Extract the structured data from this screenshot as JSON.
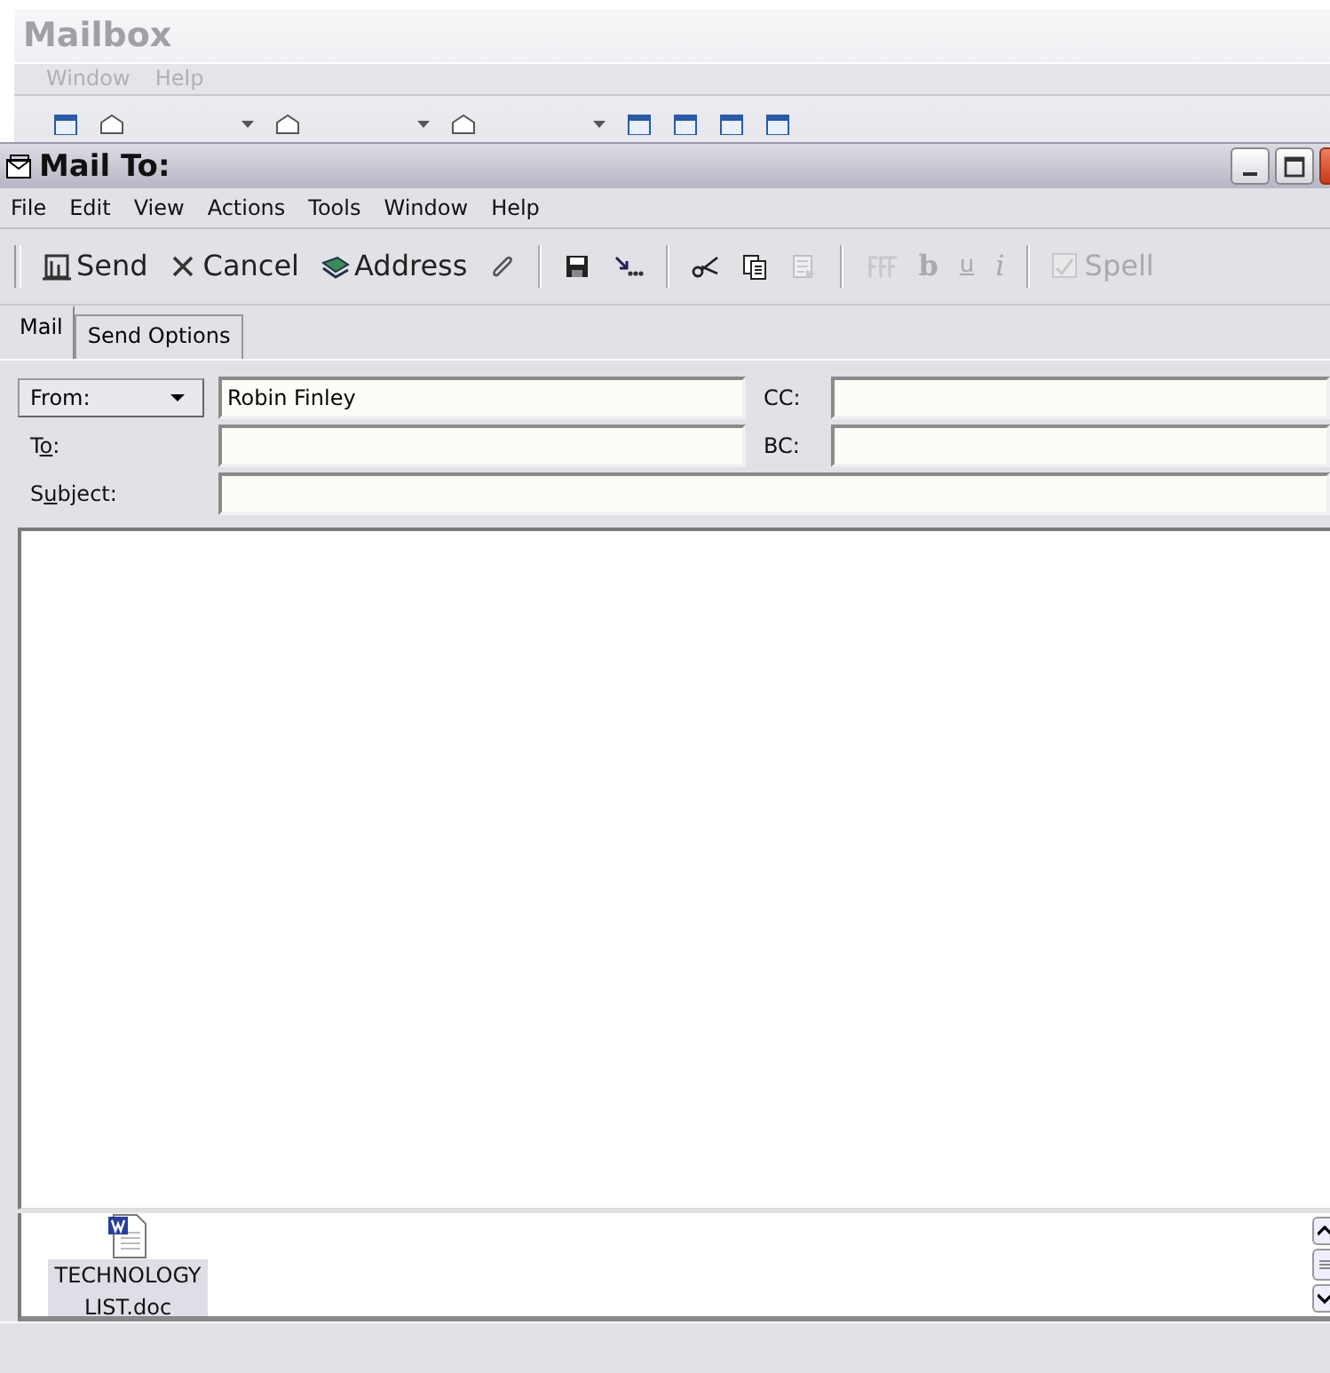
{
  "background_window": {
    "title": "Mailbox",
    "menu": [
      "Window",
      "Help"
    ],
    "toolbar": [
      {
        "kind": "icon"
      },
      {
        "kind": "split"
      },
      {
        "kind": "split"
      },
      {
        "kind": "split"
      },
      {
        "kind": "icon"
      },
      {
        "kind": "icon"
      },
      {
        "kind": "icon"
      },
      {
        "kind": "icon"
      }
    ]
  },
  "window": {
    "title": "Mail To:"
  },
  "menu": [
    "File",
    "Edit",
    "View",
    "Actions",
    "Tools",
    "Window",
    "Help"
  ],
  "toolbar": [
    {
      "kind": "send",
      "label": "Send",
      "disabled": false
    },
    {
      "kind": "cancel",
      "label": "Cancel",
      "disabled": false
    },
    {
      "kind": "address",
      "label": "Address",
      "disabled": false
    },
    {
      "kind": "attach",
      "disabled": false
    },
    {
      "kind": "sep"
    },
    {
      "kind": "save",
      "disabled": false
    },
    {
      "kind": "post",
      "disabled": false
    },
    {
      "kind": "sep"
    },
    {
      "kind": "cut",
      "disabled": false
    },
    {
      "kind": "copy",
      "disabled": false
    },
    {
      "kind": "paste",
      "disabled": true
    },
    {
      "kind": "sep"
    },
    {
      "kind": "font",
      "disabled": true
    },
    {
      "kind": "bold",
      "label": "b",
      "disabled": true
    },
    {
      "kind": "underline",
      "label": "u",
      "disabled": true
    },
    {
      "kind": "italic",
      "label": "i",
      "disabled": true
    },
    {
      "kind": "sep"
    },
    {
      "kind": "spell",
      "label": "Spell",
      "disabled": true
    }
  ],
  "tabs": [
    {
      "label": "Mail",
      "selected": true
    },
    {
      "label": "Send Options",
      "selected": false
    }
  ],
  "form": {
    "from_button": "From:",
    "from": "Robin Finley",
    "cc_label": "CC:",
    "to_label": "T**o**:",
    "bc_label": "BC:",
    "subject_label": "S**u**bject:"
  },
  "attachments": [
    {
      "name": "TECHNOLOGY LIST.doc",
      "selected": true
    }
  ]
}
